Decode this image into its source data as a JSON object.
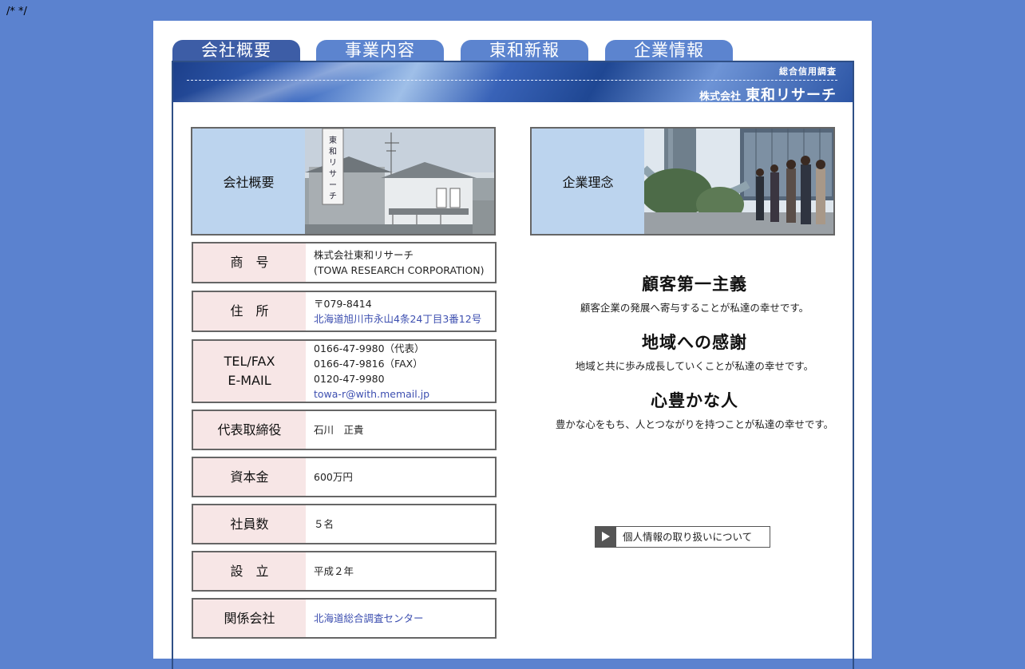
{
  "corner_text": "/* */",
  "tabs": [
    "会社概要",
    "事業内容",
    "東和新報",
    "企業情報"
  ],
  "banner": {
    "subtitle": "総合信用調査",
    "corp_prefix": "株式会社",
    "corp_name": "東和リサーチ"
  },
  "left_header": {
    "label": "会社概要",
    "photo_sign": "東和リサーチ"
  },
  "right_header": {
    "label": "企業理念"
  },
  "company_rows": [
    {
      "label": "商　号",
      "lines": [
        "株式会社東和リサーチ",
        "(TOWA RESEARCH CORPORATION)"
      ]
    },
    {
      "label": "住　所",
      "lines": [
        "〒079-8414",
        "北海道旭川市永山4条24丁目3番12号"
      ]
    },
    {
      "label_line1": "TEL/FAX",
      "label_line2": "E-MAIL",
      "lines": [
        "0166-47-9980（代表）",
        "0166-47-9816（FAX）",
        "0120-47-9980",
        "towa-r@with.memail.jp"
      ]
    },
    {
      "label": "代表取締役",
      "value": "石川　正貴"
    },
    {
      "label": "資本金",
      "value": "600万円"
    },
    {
      "label": "社員数",
      "value": "５名"
    },
    {
      "label": "設　立",
      "value": "平成２年"
    },
    {
      "label": "関係会社",
      "value": "北海道総合調査センター"
    }
  ],
  "mottos": [
    {
      "heading": "顧客第一主義",
      "text": "顧客企業の発展へ寄与することが私達の幸せです。"
    },
    {
      "heading": "地域への感謝",
      "text": "地域と共に歩み成長していくことが私達の幸せです。"
    },
    {
      "heading": "心豊かな人",
      "text": "豊かな心をもち、人とつながりを持つことが私達の幸せです。"
    }
  ],
  "privacy_button": {
    "label": "個人情報の取り扱いについて",
    "icon": "play-arrow-icon"
  },
  "colors": {
    "background": "#5b82cf",
    "tab": "#5c84cf",
    "tab_active": "#3d5da6",
    "label_pink": "#f7e6e6",
    "header_blue": "#bcd4ee",
    "link": "#3d4fb0"
  }
}
